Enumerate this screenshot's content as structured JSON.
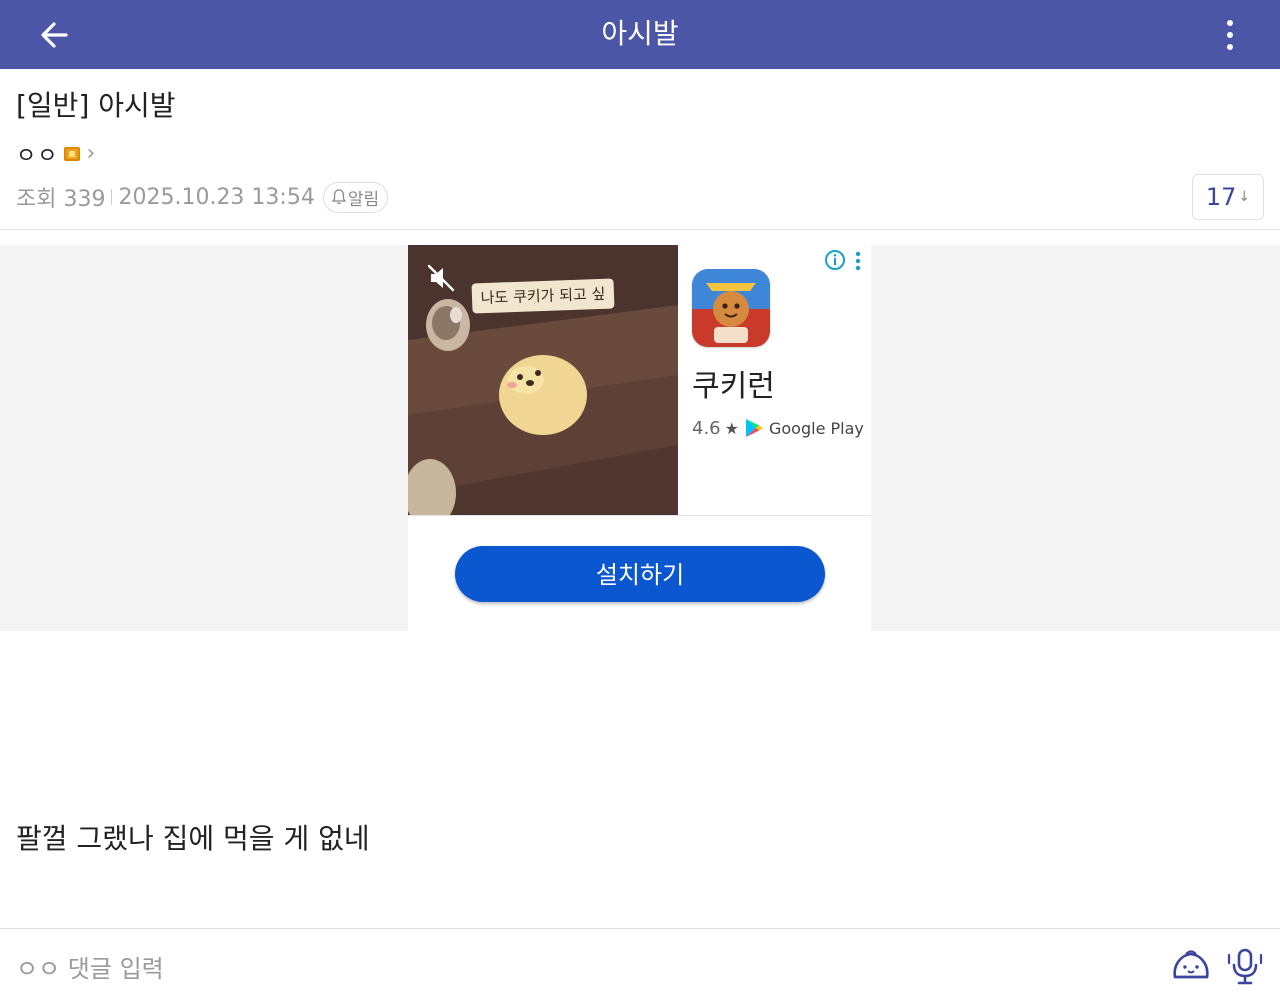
{
  "header": {
    "title": "아시발",
    "back_icon": "arrow-left-icon",
    "more_icon": "more-vertical-icon",
    "bg_color": "#4b56a7"
  },
  "post": {
    "title": "[일반] 아시발",
    "author": "ㅇㅇ",
    "views_label": "조회 339",
    "datetime": "2025.10.23 13:54",
    "alarm_label": "알림",
    "comment_count": "17",
    "comment_sort_arrow": "↓",
    "body": "팔껄 그랬나 집에 먹을 게 없네"
  },
  "ad": {
    "video_caption": "나도 쿠키가 되고 싶",
    "app_name": "쿠키런",
    "rating": "4.6",
    "store_name": "Google Play",
    "install_label": "설치하기",
    "install_color": "#0b57d0"
  },
  "comment_bar": {
    "placeholder": "ㅇㅇ 댓글 입력",
    "emoticon_icon": "dumpling-emoticon-icon",
    "mic_icon": "microphone-icon"
  }
}
